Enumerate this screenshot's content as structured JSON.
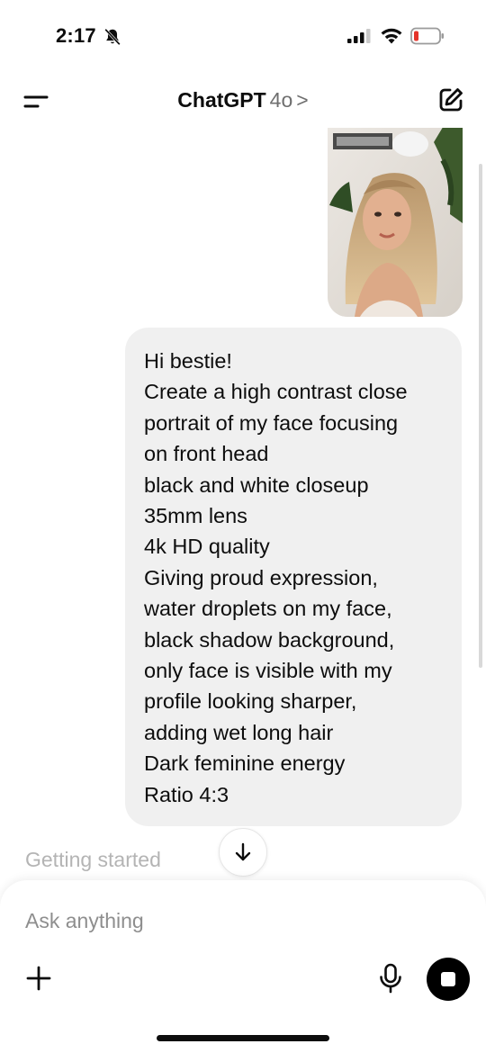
{
  "status_bar": {
    "time": "2:17",
    "icons": [
      "bell-slash-icon",
      "signal-icon",
      "wifi-icon",
      "battery-icon"
    ],
    "battery_color": "#e5332a"
  },
  "header": {
    "title": "ChatGPT",
    "model": "4o",
    "chevron": ">",
    "left_icon": "menu-icon",
    "right_icon": "new-chat-icon"
  },
  "chat": {
    "user_image": {
      "description_icon": "user-photo"
    },
    "user_message": {
      "lines": [
        "Hi bestie!",
        "Create a high contrast close",
        "portrait of my face focusing",
        "on front head",
        "black and white closeup",
        "35mm lens",
        "4k HD quality",
        "Giving proud expression,",
        "water droplets on my face,",
        "black shadow background,",
        "only face is visible with my",
        "profile looking sharper,",
        "adding wet long hair",
        "Dark feminine energy",
        "Ratio 4:3"
      ]
    },
    "status_text": "Getting started",
    "scroll_button_icon": "arrow-down-icon"
  },
  "composer": {
    "placeholder": "Ask anything",
    "left_icon": "plus-icon",
    "mic_icon": "microphone-icon",
    "action_icon": "stop-icon"
  },
  "colors": {
    "bubble_bg": "#f0f0f0",
    "text": "#0d0d0d",
    "muted": "#b4b4b4",
    "accent": "#000000"
  }
}
